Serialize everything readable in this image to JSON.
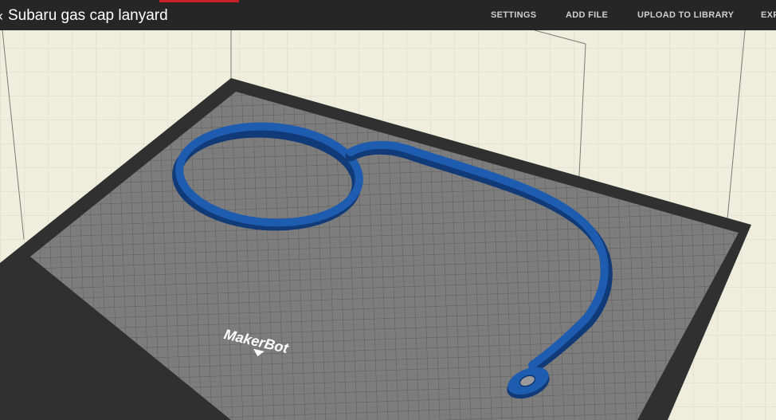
{
  "window": {
    "title": "Subaru gas cap lanyard"
  },
  "toolbar": {
    "settings_label": "SETTINGS",
    "add_file_label": "ADD FILE",
    "upload_label": "UPLOAD TO LIBRARY",
    "export_label": "EXP"
  },
  "build_plate": {
    "logo_text": "MakerBot"
  },
  "colors": {
    "toolbar_bg": "#262626",
    "accent": "#c8202a",
    "background": "#efeedd",
    "plate_frame": "#303030",
    "plate_surface": "#7d7d7d",
    "model": "#1e5cb0"
  },
  "icons": {
    "title_chevron": "chevron-left-icon"
  }
}
